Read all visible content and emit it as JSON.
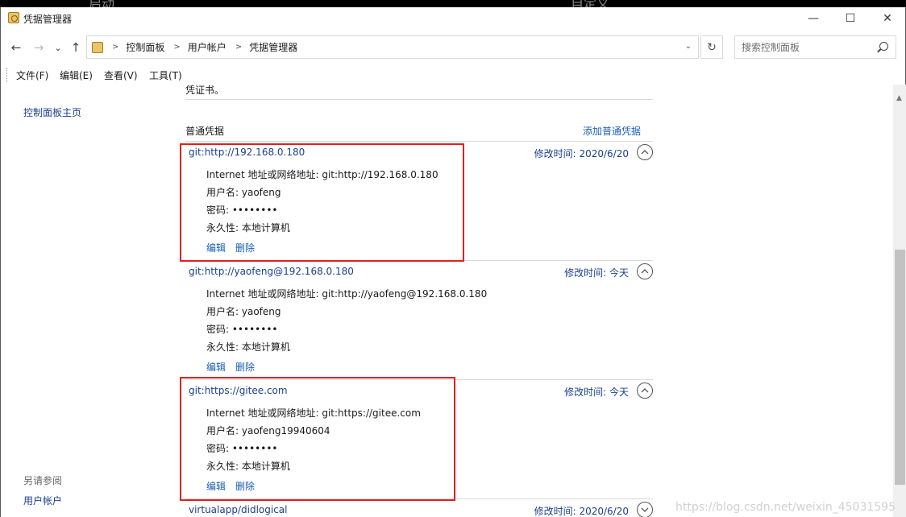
{
  "background": {
    "left_text": "启动",
    "right_text": "自定义"
  },
  "window": {
    "title": "凭据管理器"
  },
  "titlebar": {
    "minimize": "—",
    "maximize": "☐",
    "close": "✕"
  },
  "nav": {
    "back": "←",
    "forward": "→",
    "history": "⌄",
    "up": "↑",
    "breadcrumb": [
      "控制面板",
      "用户帐户",
      "凭据管理器"
    ],
    "search_placeholder": "搜索控制面板"
  },
  "menu": [
    "文件(F)",
    "编辑(E)",
    "查看(V)",
    "工具(T)"
  ],
  "left_pane": {
    "home_link": "控制面板主页",
    "see_also_heading": "另请参阅",
    "see_also_link": "用户帐户"
  },
  "content": {
    "cut_off_text": "凭证书。",
    "section_title": "普通凭据",
    "add_link": "添加普通凭据",
    "credentials": [
      {
        "name": "git:http://192.168.0.180",
        "modified": "修改时间:  2020/6/20",
        "address_line": "Internet 地址或网络地址:  git:http://192.168.0.180",
        "username_line": "用户名:  yaofeng",
        "password_line": "密码:  ••••••••",
        "persistence_line": "永久性:  本地计算机",
        "edit": "编辑",
        "delete": "删除"
      },
      {
        "name": "git:http://yaofeng@192.168.0.180",
        "modified": "修改时间:  今天",
        "address_line": "Internet 地址或网络地址:  git:http://yaofeng@192.168.0.180",
        "username_line": "用户名:  yaofeng",
        "password_line": "密码:  ••••••••",
        "persistence_line": "永久性:  本地计算机",
        "edit": "编辑",
        "delete": "删除"
      },
      {
        "name": "git:https://gitee.com",
        "modified": "修改时间:  今天",
        "address_line": "Internet 地址或网络地址:  git:https://gitee.com",
        "username_line": "用户名:  yaofeng19940604",
        "password_line": "密码:  ••••••••",
        "persistence_line": "永久性:  本地计算机",
        "edit": "编辑",
        "delete": "删除"
      },
      {
        "name": "virtualapp/didlogical",
        "modified": "修改时间:  2020/6/20"
      }
    ]
  },
  "watermark": "https://blog.csdn.net/weixin_45031595",
  "colors": {
    "link": "#1a5fb4",
    "highlight_box": "#e02020"
  }
}
